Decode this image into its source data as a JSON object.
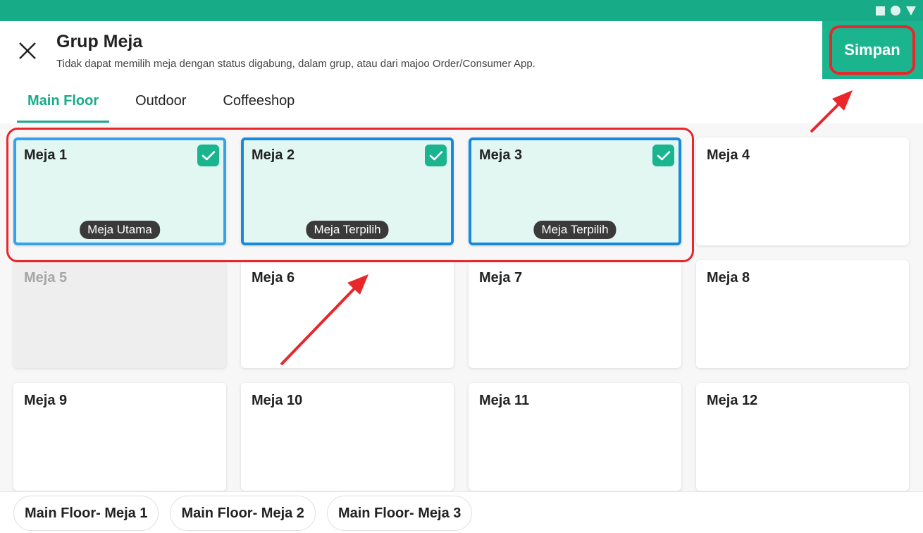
{
  "statusbar": {
    "icons": [
      "square-icon",
      "circle-icon",
      "triangle-icon"
    ]
  },
  "header": {
    "title": "Grup Meja",
    "subtitle": "Tidak dapat memilih meja dengan status digabung, dalam grup, atau dari majoo Order/Consumer App.",
    "save_label": "Simpan"
  },
  "tabs": [
    {
      "label": "Main Floor",
      "active": true
    },
    {
      "label": "Outdoor",
      "active": false
    },
    {
      "label": "Coffeeshop",
      "active": false
    }
  ],
  "tables": [
    {
      "name": "Meja 1",
      "state": "selected",
      "badge": "Meja Utama"
    },
    {
      "name": "Meja 2",
      "state": "selected",
      "badge": "Meja Terpilih"
    },
    {
      "name": "Meja 3",
      "state": "selected",
      "badge": "Meja Terpilih"
    },
    {
      "name": "Meja 4",
      "state": "available"
    },
    {
      "name": "Meja 5",
      "state": "disabled"
    },
    {
      "name": "Meja 6",
      "state": "available"
    },
    {
      "name": "Meja 7",
      "state": "available"
    },
    {
      "name": "Meja 8",
      "state": "available"
    },
    {
      "name": "Meja 9",
      "state": "available"
    },
    {
      "name": "Meja 10",
      "state": "available"
    },
    {
      "name": "Meja 11",
      "state": "available"
    },
    {
      "name": "Meja 12",
      "state": "available"
    }
  ],
  "selected_chips": [
    "Main Floor- Meja 1",
    "Main Floor- Meja 2",
    "Main Floor- Meja 3"
  ],
  "colors": {
    "brand": "#17ab88",
    "selected_border": "#1789e0",
    "main_border": "#34a3ec",
    "selected_fill": "#e3f7f2",
    "annotation": "#e9262a"
  }
}
